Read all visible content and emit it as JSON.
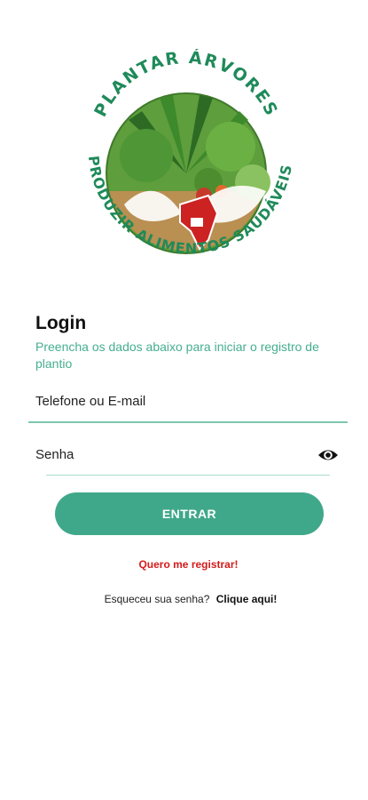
{
  "logo": {
    "top_text": "PLANTAR ÁRVORES",
    "bottom_text": "PRODUZIR ALIMENTOS SAUDÁVEIS"
  },
  "login": {
    "title": "Login",
    "subtitle": "Preencha os dados abaixo para iniciar o registro de plantio"
  },
  "form": {
    "phone_placeholder": "Telefone ou E-mail",
    "password_placeholder": "Senha",
    "toggle_icon": "eye-icon",
    "submit_label": "ENTRAR"
  },
  "links": {
    "register_label": "Quero me registrar!",
    "forgot_text": "Esqueceu sua senha?",
    "forgot_link": "Clique aqui!"
  },
  "colors": {
    "accent": "#40a88a",
    "subtitle": "#45ae8e",
    "link_red": "#d41a1a"
  }
}
